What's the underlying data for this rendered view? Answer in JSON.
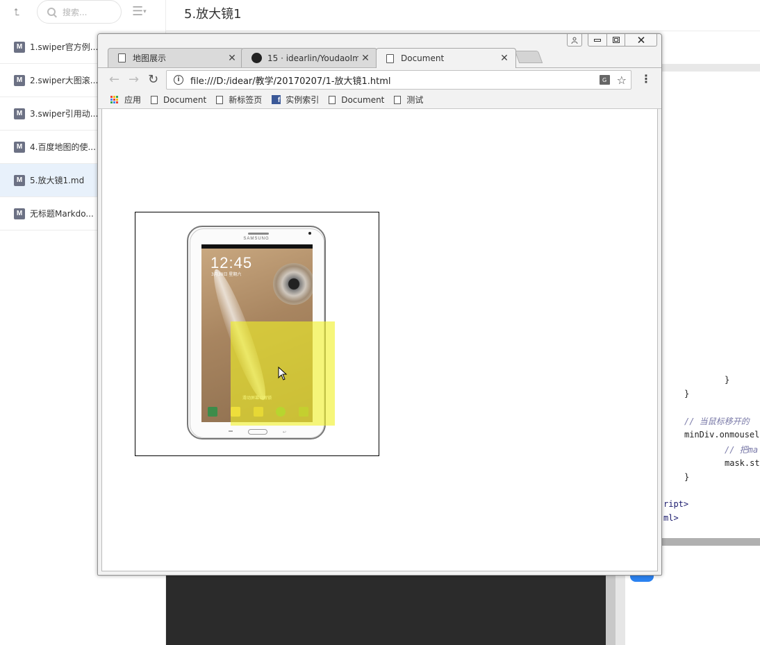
{
  "sidebar": {
    "search_placeholder": "搜索...",
    "items": [
      {
        "label": "1.swiper官方例...",
        "active": false
      },
      {
        "label": "2.swiper大图滚...",
        "active": false
      },
      {
        "label": "3.swiper引用动...",
        "active": false
      },
      {
        "label": "4.百度地图的使...",
        "active": false
      },
      {
        "label": "5.放大镜1.md",
        "active": true
      },
      {
        "label": "无标题Markdo...",
        "active": false
      }
    ],
    "item_icon_letter": "M"
  },
  "document": {
    "title": "5.放大镜1"
  },
  "editor": {
    "lines": [
      {
        "text": "}",
        "kind": "code"
      },
      {
        "text": "}",
        "kind": "code"
      },
      {
        "text": "// 当鼠标移开的",
        "kind": "comment"
      },
      {
        "text": "minDiv.onmousel",
        "kind": "code"
      },
      {
        "text": "// 把ma",
        "kind": "comment"
      },
      {
        "text": "mask.st",
        "kind": "code"
      },
      {
        "text": "}",
        "kind": "code"
      },
      {
        "text": "ript>",
        "kind": "tag"
      },
      {
        "text": "ml>",
        "kind": "tag"
      }
    ]
  },
  "browser": {
    "tabs": [
      {
        "label": "地图展示",
        "icon": "page-icon",
        "active": false
      },
      {
        "label": "15 · idearlin/YoudaoIm",
        "icon": "github-icon",
        "active": false
      },
      {
        "label": "Document",
        "icon": "page-icon",
        "active": true
      }
    ],
    "url": "file:///D:/idear/教学/20170207/1-放大镜1.html",
    "info_icon": "i",
    "bookmarks": [
      {
        "label": "应用",
        "icon": "apps-icon"
      },
      {
        "label": "Document",
        "icon": "page-icon"
      },
      {
        "label": "新标签页",
        "icon": "page-icon"
      },
      {
        "label": "实例索引",
        "icon": "facebook-icon"
      },
      {
        "label": "Document",
        "icon": "page-icon"
      },
      {
        "label": "测试",
        "icon": "page-icon"
      }
    ]
  },
  "page": {
    "tablet": {
      "brand": "SAMSUNG",
      "clock": "12:45",
      "date": "3月30日 星期六",
      "unlock_text": "滑动屏幕以解锁"
    },
    "mask_color": "#f0f028"
  },
  "colors": {
    "accent_blue": "#2b82f0",
    "sidebar_active_bg": "#e8f1fb",
    "md_icon": "#6c7184"
  }
}
